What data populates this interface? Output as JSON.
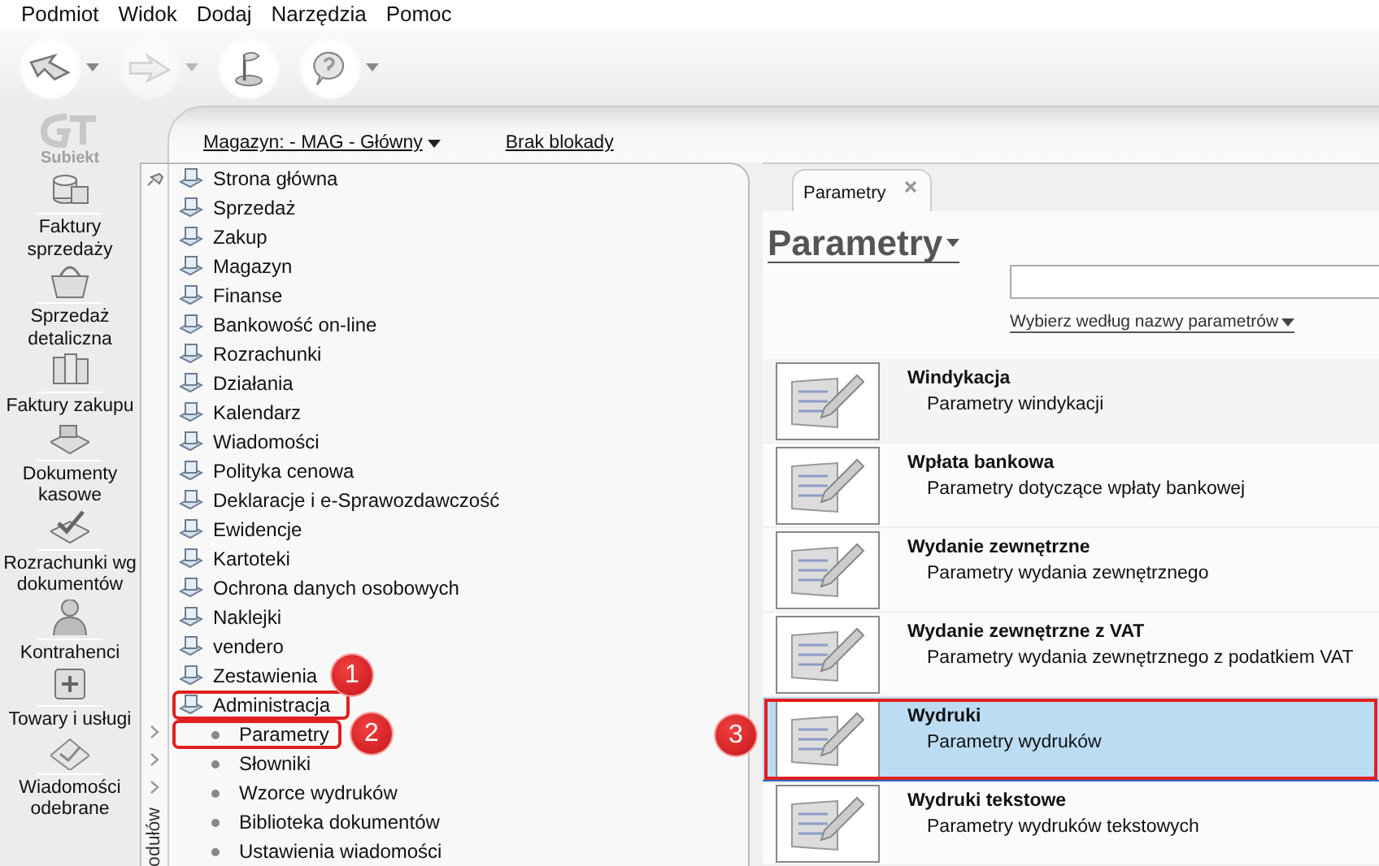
{
  "menu": [
    "Podmiot",
    "Widok",
    "Dodaj",
    "Narzędzia",
    "Pomoc"
  ],
  "toolbar_buttons": [
    {
      "dropdown": true,
      "disabled": false
    },
    {
      "dropdown": true,
      "disabled": true
    },
    {
      "dropdown": false,
      "disabled": false
    },
    {
      "dropdown": true,
      "disabled": false
    }
  ],
  "logo": {
    "text": "Subiekt"
  },
  "nav": [
    {
      "label": "Faktury sprzedaży"
    },
    {
      "label": "Sprzedaż detaliczna"
    },
    {
      "label": "Faktury zakupu"
    },
    {
      "label": "Dokumenty kasowe"
    },
    {
      "label": "Rozrachunki wg dokumentów"
    },
    {
      "label": "Kontrahenci"
    },
    {
      "label": "Towary i usługi"
    },
    {
      "label": "Wiadomości odebrane"
    }
  ],
  "header": {
    "warehouse": "Magazyn: - MAG - Główny",
    "lock": "Brak blokady"
  },
  "modules_label": "odułów",
  "tree": [
    {
      "label": "Strona główna",
      "outlined": false
    },
    {
      "label": "Sprzedaż",
      "outlined": false
    },
    {
      "label": "Zakup",
      "outlined": false
    },
    {
      "label": "Magazyn",
      "outlined": false
    },
    {
      "label": "Finanse",
      "outlined": false
    },
    {
      "label": "Bankowość on-line",
      "outlined": false
    },
    {
      "label": "Rozrachunki",
      "outlined": false
    },
    {
      "label": "Działania",
      "outlined": false
    },
    {
      "label": "Kalendarz",
      "outlined": false
    },
    {
      "label": "Wiadomości",
      "outlined": false
    },
    {
      "label": "Polityka cenowa",
      "outlined": false
    },
    {
      "label": "Deklaracje i e-Sprawozdawczość",
      "outlined": false
    },
    {
      "label": "Ewidencje",
      "outlined": false
    },
    {
      "label": "Kartoteki",
      "outlined": false
    },
    {
      "label": "Ochrona danych osobowych",
      "outlined": false
    },
    {
      "label": "Naklejki",
      "outlined": false
    },
    {
      "label": "vendero",
      "outlined": false
    },
    {
      "label": "Zestawienia",
      "outlined": false
    },
    {
      "label": "Administracja",
      "outlined": true,
      "badge": "1",
      "children": [
        {
          "label": "Parametry",
          "outlined": true,
          "badge": "2"
        },
        {
          "label": "Słowniki",
          "outlined": false
        },
        {
          "label": "Wzorce wydruków",
          "outlined": false
        },
        {
          "label": "Biblioteka dokumentów",
          "outlined": false
        },
        {
          "label": "Ustawienia wiadomości",
          "outlined": false
        }
      ]
    }
  ],
  "tabs": [
    {
      "label": "Parametry",
      "selected": true
    }
  ],
  "page": {
    "title": "Parametry",
    "filter_link": "Wybierz według nazwy parametrów"
  },
  "items": [
    {
      "title": "Windykacja",
      "description": "Parametry windykacji",
      "selected": false,
      "outlined": false
    },
    {
      "title": "Wpłata bankowa",
      "description": "Parametry dotyczące wpłaty bankowej",
      "selected": false,
      "outlined": false
    },
    {
      "title": "Wydanie zewnętrzne",
      "description": "Parametry wydania zewnętrznego",
      "selected": false,
      "outlined": false
    },
    {
      "title": "Wydanie zewnętrzne z VAT",
      "description": "Parametry wydania zewnętrznego z podatkiem VAT",
      "selected": false,
      "outlined": false
    },
    {
      "title": "Wydruki",
      "description": "Parametry wydruków",
      "selected": true,
      "outlined": true,
      "badge": "3"
    },
    {
      "title": "Wydruki tekstowe",
      "description": "Parametry wydruków tekstowych",
      "selected": false,
      "outlined": false
    }
  ]
}
